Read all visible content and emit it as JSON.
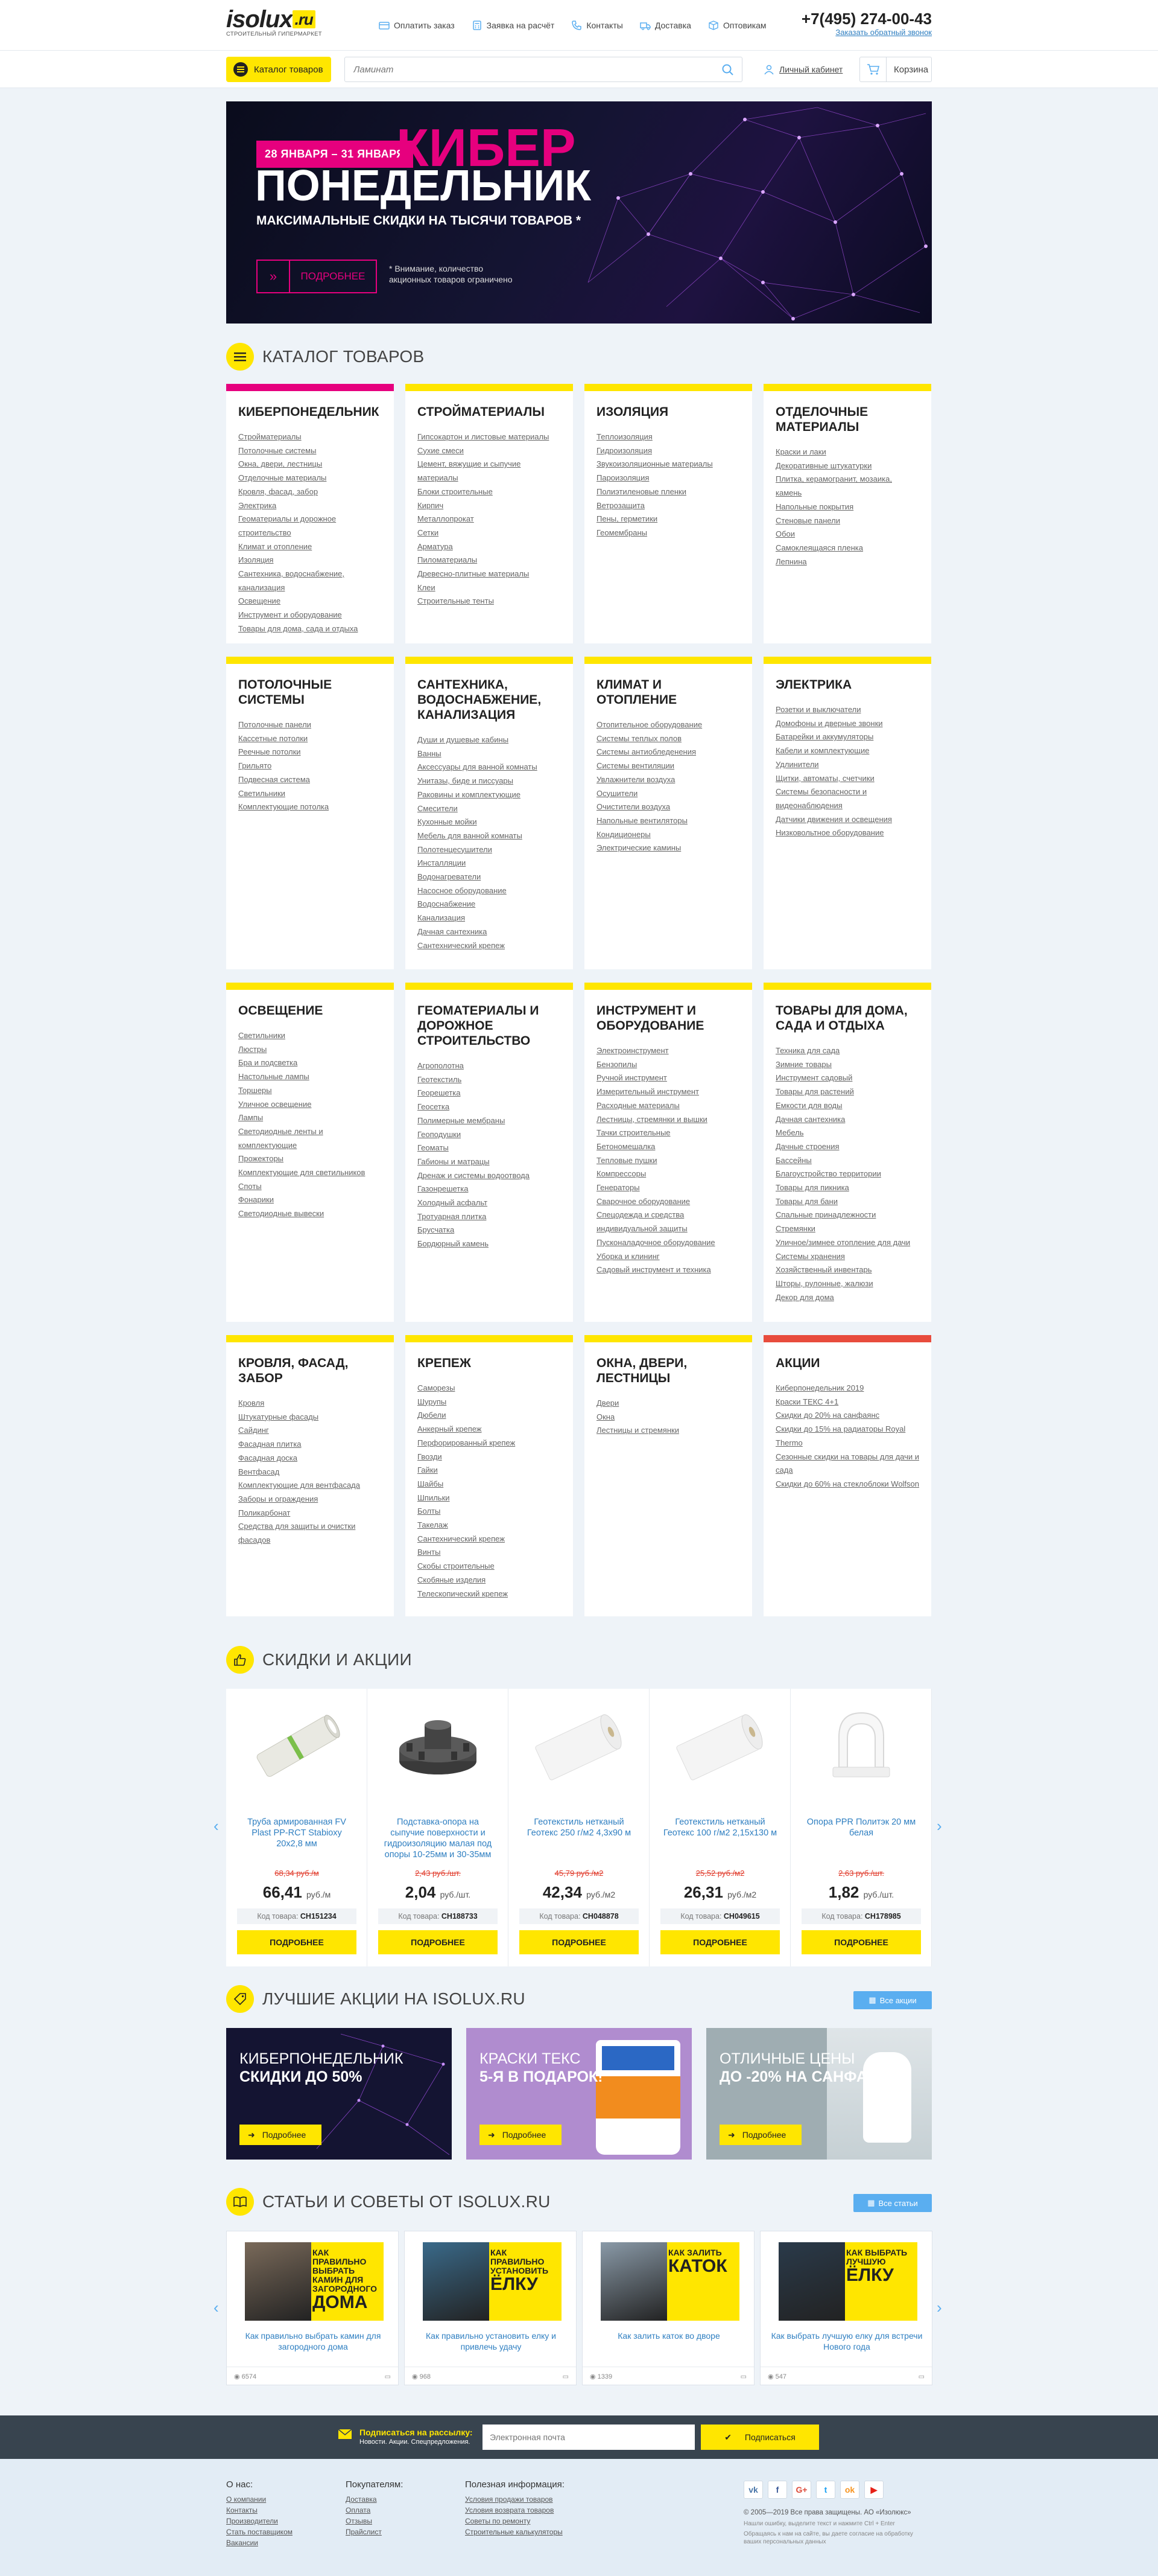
{
  "header": {
    "logo_word": "isolux",
    "logo_ru": ".ru",
    "logo_tagline": "СТРОИТЕЛЬНЫЙ ГИПЕРМАРКЕТ",
    "nav": [
      {
        "label": "Оплатить заказ",
        "icon": "card-icon"
      },
      {
        "label": "Заявка на расчёт",
        "icon": "calculator-icon"
      },
      {
        "label": "Контакты",
        "icon": "phone-icon"
      },
      {
        "label": "Доставка",
        "icon": "truck-icon"
      },
      {
        "label": "Оптовикам",
        "icon": "box-icon"
      }
    ],
    "phone": "+7(495) 274-00-43",
    "callback": "Заказать обратный звонок"
  },
  "searchbar": {
    "catalog_button": "Каталог товаров",
    "placeholder": "Ламинат",
    "account": "Личный кабинет",
    "cart": "Корзина"
  },
  "banner": {
    "dates": "28 ЯНВАРЯ – 31 ЯНВАРЯ",
    "title_1": "КИБЕР",
    "title_2": "ПОНЕДЕЛЬНИК",
    "subtitle": "МАКСИМАЛЬНЫЕ СКИДКИ НА ТЫСЯЧИ ТОВАРОВ *",
    "button": "ПОДРОБНЕЕ",
    "note": "* Внимание, количество акционных товаров ограничено",
    "accent": "#e6007e"
  },
  "catalog": {
    "title": "КАТАЛОГ ТОВАРОВ",
    "cards": [
      {
        "title": "КИБЕРПОНЕДЕЛЬНИК",
        "items": [
          "Стройматериалы",
          "Потолочные системы",
          "Окна, двери, лестницы",
          "Отделочные материалы",
          "Кровля, фасад, забор",
          "Электрика",
          "Геоматериалы и дорожное строительство",
          "Климат и отопление",
          "Изоляция",
          "Сантехника, водоснабжение, канализация",
          "Освещение",
          "Инструмент и оборудование",
          "Товары для дома, сада и отдыха"
        ]
      },
      {
        "title": "СТРОЙМАТЕРИАЛЫ",
        "items": [
          "Гипсокартон и листовые материалы",
          "Сухие смеси",
          "Цемент, вяжущие и сыпучие материалы",
          "Блоки строительные",
          "Кирпич",
          "Металлопрокат",
          "Сетки",
          "Арматура",
          "Пиломатериалы",
          "Древесно-плитные материалы",
          "Клеи",
          "Строительные тенты"
        ]
      },
      {
        "title": "ИЗОЛЯЦИЯ",
        "items": [
          "Теплоизоляция",
          "Гидроизоляция",
          "Звукоизоляционные материалы",
          "Пароизоляция",
          "Полиэтиленовые пленки",
          "Ветрозащита",
          "Пены, герметики",
          "Геомембраны"
        ]
      },
      {
        "title": "ОТДЕЛОЧНЫЕ МАТЕРИАЛЫ",
        "items": [
          "Краски и лаки",
          "Декоративные штукатурки",
          "Плитка, керамогранит, мозаика, камень",
          "Напольные покрытия",
          "Стеновые панели",
          "Обои",
          "Самоклеящаяся пленка",
          "Лепнина"
        ]
      },
      {
        "title": "ПОТОЛОЧНЫЕ СИСТЕМЫ",
        "items": [
          "Потолочные панели",
          "Кассетные потолки",
          "Реечные потолки",
          "Грильято",
          "Подвесная система",
          "Светильники",
          "Комплектующие потолка"
        ]
      },
      {
        "title": "САНТЕХНИКА, ВОДОСНАБЖЕНИЕ, КАНАЛИЗАЦИЯ",
        "items": [
          "Души и душевые кабины",
          "Ванны",
          "Аксессуары для ванной комнаты",
          "Унитазы, биде и писсуары",
          "Раковины и комплектующие",
          "Смесители",
          "Кухонные мойки",
          "Мебель для ванной комнаты",
          "Полотенцесушители",
          "Инсталляции",
          "Водонагреватели",
          "Насосное оборудование",
          "Водоснабжение",
          "Канализация",
          "Дачная сантехника",
          "Сантехнический крепеж"
        ]
      },
      {
        "title": "КЛИМАТ И ОТОПЛЕНИЕ",
        "items": [
          "Отопительное оборудование",
          "Системы теплых полов",
          "Системы антиобледенения",
          "Системы вентиляции",
          "Увлажнители воздуха",
          "Осушители",
          "Очистители воздуха",
          "Напольные вентиляторы",
          "Кондиционеры",
          "Электрические камины"
        ]
      },
      {
        "title": "ЭЛЕКТРИКА",
        "items": [
          "Розетки и выключатели",
          "Домофоны и дверные звонки",
          "Батарейки и аккумуляторы",
          "Кабели и комплектующие",
          "Удлинители",
          "Щитки, автоматы, счетчики",
          "Системы безопасности и видеонаблюдения",
          "Датчики движения и освещения",
          "Низковольтное оборудование"
        ]
      },
      {
        "title": "ОСВЕЩЕНИЕ",
        "items": [
          "Светильники",
          "Люстры",
          "Бра и подсветка",
          "Настольные лампы",
          "Торшеры",
          "Уличное освещение",
          "Лампы",
          "Светодиодные ленты и комплектующие",
          "Прожекторы",
          "Комплектующие для светильников",
          "Споты",
          "Фонарики",
          "Светодиодные вывески"
        ]
      },
      {
        "title": "ГЕОМАТЕРИАЛЫ И ДОРОЖНОЕ СТРОИТЕЛЬСТВО",
        "items": [
          "Агрополотна",
          "Геотекстиль",
          "Георешетка",
          "Геосетка",
          "Полимерные мембраны",
          "Геоподушки",
          "Геоматы",
          "Габионы и матрацы",
          "Дренаж и системы водоотвода",
          "Газонрешетка",
          "Холодный асфальт",
          "Тротуарная плитка",
          "Брусчатка",
          "Бордюрный камень"
        ]
      },
      {
        "title": "ИНСТРУМЕНТ И ОБОРУДОВАНИЕ",
        "items": [
          "Электроинструмент",
          "Бензопилы",
          "Ручной инструмент",
          "Измерительный инструмент",
          "Расходные материалы",
          "Лестницы, стремянки и вышки",
          "Тачки строительные",
          "Бетономешалка",
          "Тепловые пушки",
          "Компрессоры",
          "Генераторы",
          "Сварочное оборудование",
          "Спецодежда и средства индивидуальной защиты",
          "Пусконаладочное оборудование",
          "Уборка и клининг",
          "Садовый инструмент и техника"
        ]
      },
      {
        "title": "ТОВАРЫ ДЛЯ ДОМА, САДА И ОТДЫХА",
        "items": [
          "Техника для сада",
          "Зимние товары",
          "Инструмент садовый",
          "Товары для растений",
          "Емкости для воды",
          "Дачная сантехника",
          "Мебель",
          "Дачные строения",
          "Бассейны",
          "Благоустройство территории",
          "Товары для пикника",
          "Товары для бани",
          "Спальные принадлежности",
          "Стремянки",
          "Уличное/зимнее отопление для дачи",
          "Системы хранения",
          "Хозяйственный инвентарь",
          "Шторы, рулонные, жалюзи",
          "Декор для дома"
        ]
      },
      {
        "title": "КРОВЛЯ, ФАСАД, ЗАБОР",
        "items": [
          "Кровля",
          "Штукатурные фасады",
          "Сайдинг",
          "Фасадная плитка",
          "Фасадная доска",
          "Вентфасад",
          "Комплектующие для вентфасада",
          "Заборы и ограждения",
          "Поликарбонат",
          "Средства для защиты и очистки фасадов"
        ]
      },
      {
        "title": "КРЕПЕЖ",
        "items": [
          "Саморезы",
          "Шурупы",
          "Дюбели",
          "Анкерный крепеж",
          "Перфорированный крепеж",
          "Гвозди",
          "Гайки",
          "Шайбы",
          "Шпильки",
          "Болты",
          "Такелаж",
          "Сантехнический крепеж",
          "Винты",
          "Скобы строительные",
          "Скобяные изделия",
          "Телескопический крепеж"
        ]
      },
      {
        "title": "ОКНА, ДВЕРИ, ЛЕСТНИЦЫ",
        "items": [
          "Двери",
          "Окна",
          "Лестницы и стремянки"
        ]
      },
      {
        "title": "АКЦИИ",
        "items": [
          "Киберпонедельник 2019",
          "Краски ТЕКС 4+1",
          "Скидки до 20% на санфаянс",
          "Скидки до 15% на радиаторы Royal Thermo",
          "Сезонные скидки на товары для дачи и сада",
          "Скидки до 60% на стеклоблоки Wolfson"
        ]
      }
    ]
  },
  "sale": {
    "title": "СКИДКИ И АКЦИИ",
    "products": [
      {
        "name": "Труба армированная FV Plast PP-RCT Stabioxy 20х2,8 мм",
        "old": "68,34 руб./м",
        "price": "66,41",
        "unit": "руб./м",
        "code_label": "Код товара:",
        "code": "СН151234",
        "button": "ПОДРОБНЕЕ"
      },
      {
        "name": "Подставка-опора на сыпучие поверхности и гидроизоляцию малая под опоры 10-25мм и 30-35мм",
        "old": "2,43 руб./шт.",
        "price": "2,04",
        "unit": "руб./шт.",
        "code_label": "Код товара:",
        "code": "СН188733",
        "button": "ПОДРОБНЕЕ"
      },
      {
        "name": "Геотекстиль нетканый Геотекс 250 г/м2 4,3х90 м",
        "old": "45,79 руб./м2",
        "price": "42,34",
        "unit": "руб./м2",
        "code_label": "Код товара:",
        "code": "СН048878",
        "button": "ПОДРОБНЕЕ"
      },
      {
        "name": "Геотекстиль нетканый Геотекс 100 г/м2 2,15х130 м",
        "old": "25,52 руб./м2",
        "price": "26,31",
        "unit": "руб./м2",
        "code_label": "Код товара:",
        "code": "СН049615",
        "button": "ПОДРОБНЕЕ"
      },
      {
        "name": "Опора PPR Политэк 20 мм белая",
        "old": "2,63 руб./шт.",
        "price": "1,82",
        "unit": "руб./шт.",
        "code_label": "Код товара:",
        "code": "СН178985",
        "button": "ПОДРОБНЕЕ"
      }
    ]
  },
  "best": {
    "title": "ЛУЧШИЕ АКЦИИ НА ISOLUX.RU",
    "all_label": "Все акции",
    "promos": [
      {
        "line1": "КИБЕРПОНЕДЕЛЬНИК",
        "line2": "СКИДКИ ДО 50%",
        "button": "Подробнее"
      },
      {
        "line1": "КРАСКИ ТЕКС",
        "line2": "5-Я В ПОДАРОК!",
        "button": "Подробнее"
      },
      {
        "line1": "ОТЛИЧНЫЕ ЦЕНЫ",
        "line2": "ДО -20% НА САНФАЯНС",
        "button": "Подробнее"
      }
    ]
  },
  "articles": {
    "title": "СТАТЬИ И СОВЕТЫ ОТ ISOLUX.RU",
    "all_label": "Все статьи",
    "items": [
      {
        "h_small": "КАК ПРАВИЛЬНО ВЫБРАТЬ КАМИН ДЛЯ ЗАГОРОДНОГО",
        "h_big": "ДОМА",
        "title": "Как правильно выбрать камин для загородного дома",
        "views": "6574"
      },
      {
        "h_small": "КАК ПРАВИЛЬНО УСТАНОВИТЬ",
        "h_big": "ЁЛКУ",
        "title": "Как правильно установить елку и привлечь удачу",
        "views": "968"
      },
      {
        "h_small": "КАК ЗАЛИТЬ",
        "h_big": "КАТОК",
        "title": "Как залить каток во дворе",
        "views": "1339"
      },
      {
        "h_small": "КАК ВЫБРАТЬ ЛУЧШУЮ",
        "h_big": "ЁЛКУ",
        "title": "Как выбрать лучшую елку для встречи Нового года",
        "views": "547"
      }
    ]
  },
  "subscribe": {
    "label": "Подписаться на рассылку:",
    "sub": "Новости. Акции. Спецпредложения.",
    "placeholder": "Электронная почта",
    "button": "Подписаться"
  },
  "footer": {
    "col1": {
      "title": "О нас:",
      "links": [
        "О компании",
        "Контакты",
        "Производители",
        "Стать поставщиком",
        "Вакансии"
      ]
    },
    "col2": {
      "title": "Покупателям:",
      "links": [
        "Доставка",
        "Оплата",
        "Отзывы",
        "Прайслист"
      ]
    },
    "col3": {
      "title": "Полезная информация:",
      "links": [
        "Условия продажи товаров",
        "Условия возврата товаров",
        "Советы по ремонту",
        "Строительные калькуляторы"
      ]
    },
    "social": [
      "vk",
      "f",
      "G+",
      "tw",
      "ok",
      "yt"
    ],
    "copyright": "© 2005—2019 Все права защищены. АО «Изолюкс»",
    "hint": "Нашли ошибку, выделите текст и нажмите Ctrl + Enter",
    "privacy": "Обращаясь к нам на сайте, вы даете согласие на обработку ваших персональных данных"
  }
}
